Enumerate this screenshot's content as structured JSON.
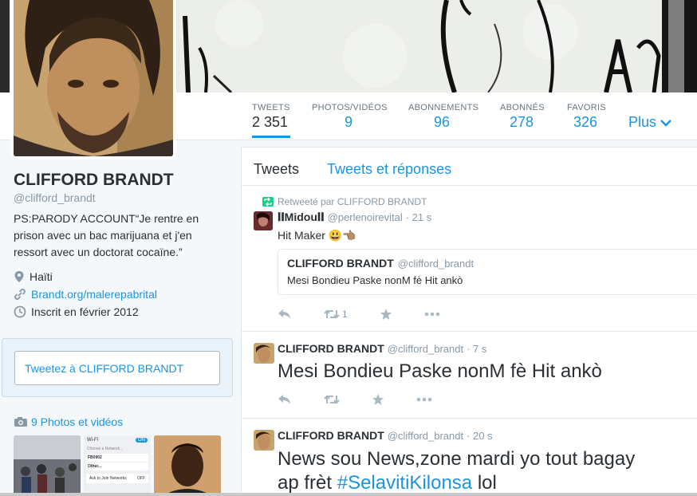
{
  "stats": [
    {
      "label": "TWEETS",
      "value": "2 351"
    },
    {
      "label": "PHOTOS/VIDÉOS",
      "value": "9"
    },
    {
      "label": "ABONNEMENTS",
      "value": "96"
    },
    {
      "label": "ABONNÉS",
      "value": "278"
    },
    {
      "label": "FAVORIS",
      "value": "326"
    }
  ],
  "more_label": "Plus",
  "profile": {
    "name": "CLIFFORD BRANDT",
    "handle": "@clifford_brandt",
    "bio": "PS:PARODY ACCOUNT“Je rentre en prison avec un bac marijuana et j'en ressort avec un doctorat cocaïne.”",
    "location": "Haïti",
    "website": "Brandt.org/malerepabrital",
    "joined": "Inscrit en février 2012"
  },
  "tweet_to_placeholder": "Tweetez à CLIFFORD BRANDT",
  "photos_label": "9 Photos et vidéos",
  "thumb_labels": {
    "wifi": "Wi-Fi",
    "network": "Choose a Network...",
    "fb": "FB0902",
    "other": "Other...",
    "ask": "Ask to Join Networks",
    "off": "OFF",
    "on": "ON"
  },
  "tabs": {
    "tweets": "Tweets",
    "replies": "Tweets et réponses"
  },
  "tweets": [
    {
      "retweet_note": "Retweeté par CLIFFORD BRANDT",
      "author": "𝐈𝐈Midou𝐈𝐈",
      "handle": "@perlenoirevital",
      "time": "· 21 s",
      "text": "Hit Maker 😃👈🏽",
      "quote_author": "CLIFFORD BRANDT",
      "quote_handle": "@clifford_brandt",
      "quote_text": "Mesi Bondieu Paske nonM fè Hit ankò",
      "retweets": "1"
    },
    {
      "author": "CLIFFORD BRANDT",
      "handle": "@clifford_brandt",
      "time": "· 7 s",
      "text": "Mesi Bondieu Paske nonM fè Hit ankò"
    },
    {
      "author": "CLIFFORD BRANDT",
      "handle": "@clifford_brandt",
      "time": "· 20 s",
      "text_line1": "News sou News,zone mardi yo tout bagay",
      "text_line2_plain": "ap frèt ",
      "hashtag": "#SelavitiKilonsa",
      "text_line2_end": " lol"
    }
  ],
  "colors": {
    "accent": "#1b95e0",
    "retweet_green": "#19cf86",
    "text": "#292f33",
    "muted": "#8899a6"
  }
}
